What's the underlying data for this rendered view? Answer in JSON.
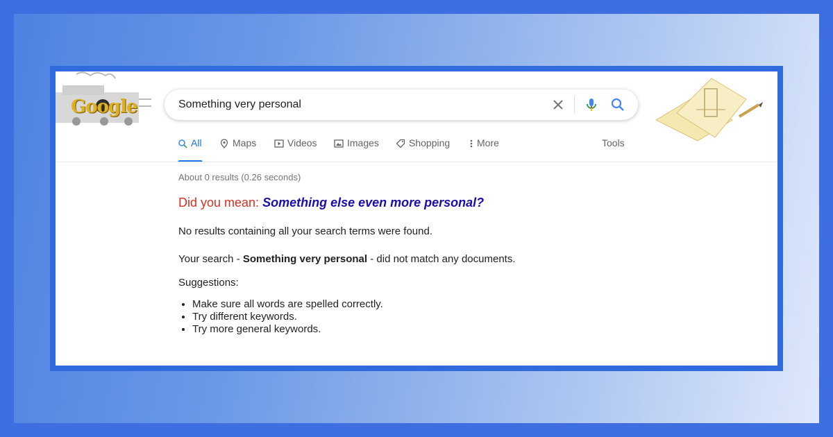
{
  "search": {
    "query": "Something very personal"
  },
  "logo": {
    "text": "Google"
  },
  "tabs": [
    {
      "label": "All",
      "icon": "search-icon",
      "active": true
    },
    {
      "label": "Maps",
      "icon": "map-pin-icon"
    },
    {
      "label": "Videos",
      "icon": "play-icon"
    },
    {
      "label": "Images",
      "icon": "image-icon"
    },
    {
      "label": "Shopping",
      "icon": "tag-icon"
    },
    {
      "label": "More",
      "icon": "more-vert-icon"
    }
  ],
  "tools_label": "Tools",
  "results": {
    "stats": "About 0 results (0.26 seconds)",
    "did_you_mean_label": "Did you mean:",
    "did_you_mean_suggestion": "Something else even more personal?",
    "no_results": "No results containing all your search terms were found.",
    "your_search_prefix": "Your search -",
    "your_search_query": "Something very personal",
    "your_search_suffix": "- did not match any documents.",
    "suggestions_label": "Suggestions:",
    "suggestions": [
      "Make sure all words are spelled correctly.",
      "Try different keywords.",
      "Try more general keywords."
    ]
  },
  "colors": {
    "accent": "#1a73e8",
    "link": "#1a0dab",
    "did_you_mean": "#d93025",
    "frame": "#2f6bdc"
  }
}
